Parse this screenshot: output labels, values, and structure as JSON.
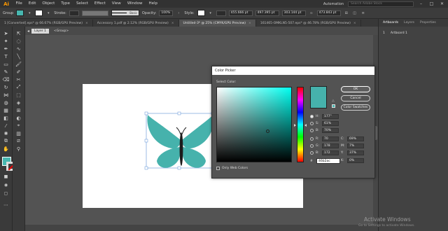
{
  "app": {
    "logo": "Ai"
  },
  "menu": [
    "File",
    "Edit",
    "Object",
    "Type",
    "Select",
    "Effect",
    "View",
    "Window",
    "Help"
  ],
  "menu_right": {
    "workspace": "Automation",
    "search_placeholder": "Search Adobe Stock"
  },
  "control_bar": {
    "selection": "Group",
    "fill_color": "#48b7b0",
    "stroke_label": "Stroke:",
    "stroke_style": "Basic",
    "opacity_label": "Opacity:",
    "opacity_value": "100%",
    "style_label": "Style:",
    "x_value": "455.666 pt",
    "y_value": "497.395 pt",
    "w_value": "303.144 pt",
    "h_value": "473.843 pt"
  },
  "tabs": [
    {
      "label": "1 [Converted].eps* @ 66.67% (RGB/GPU Preview)",
      "active": false
    },
    {
      "label": "Accessory 1.pdf @ 2.12% (RGB/GPU Preview)",
      "active": false
    },
    {
      "label": "Untitled-3* @ 25% (CMYK/GPU Preview)",
      "active": true
    },
    {
      "label": "161465-OMKLN5-507.eps* @ 46.78% (RGB/GPU Preview)",
      "active": false
    }
  ],
  "breadcrumb": {
    "layer": "Layer 1",
    "group": "<Group>"
  },
  "panel": {
    "tabs": [
      "Artboards",
      "Layers",
      "Properties"
    ],
    "artboard_row": {
      "index": "1",
      "name": "Artboard 1"
    }
  },
  "color_picker": {
    "title": "Color Picker",
    "select_label": "Select Color:",
    "buttons": {
      "ok": "OK",
      "cancel": "Cancel",
      "swatches": "Color Swatches"
    },
    "preview_color": "#46b2ac",
    "hsb": [
      {
        "label": "H:",
        "value": "177°"
      },
      {
        "label": "S:",
        "value": "61%"
      },
      {
        "label": "B:",
        "value": "70%"
      }
    ],
    "rgb": [
      {
        "label": "R:",
        "value": "70"
      },
      {
        "label": "G:",
        "value": "178"
      },
      {
        "label": "B:",
        "value": "172"
      }
    ],
    "cmyk": [
      {
        "label": "C:",
        "value": "69%"
      },
      {
        "label": "M:",
        "value": "7%"
      },
      {
        "label": "Y:",
        "value": "37%"
      },
      {
        "label": "K:",
        "value": "0%"
      }
    ],
    "hex_label": "#",
    "hex": "46b2ac",
    "web_colors_label": "Only Web Colors"
  },
  "watermark": {
    "title": "Activate Windows",
    "subtitle": "Go to Settings to activate Windows."
  }
}
